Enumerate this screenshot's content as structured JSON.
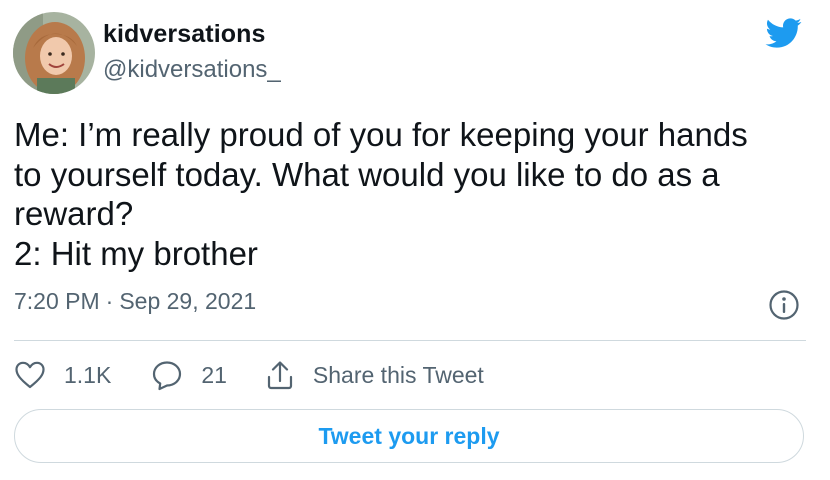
{
  "user": {
    "display_name": "kidversations",
    "handle": "@kidversations_"
  },
  "tweet": {
    "lines": [
      "Me: I’m really proud of you for keeping your hands",
      "to yourself today. What would you like to do as a",
      "reward?",
      "2: Hit my brother"
    ],
    "time": "7:20 PM",
    "separator": "·",
    "date": "Sep 29, 2021"
  },
  "actions": {
    "likes": "1.1K",
    "replies": "21",
    "share_label": "Share this Tweet"
  },
  "reply_button_label": "Tweet your reply",
  "icons": {
    "brand": "twitter-bird-icon",
    "info": "info-icon",
    "like": "heart-icon",
    "reply": "speech-bubble-icon",
    "share": "share-icon"
  },
  "colors": {
    "brand_blue": "#1d9bf0",
    "text_primary": "#0f1419",
    "text_secondary": "#536471",
    "border": "#cfd9de"
  }
}
